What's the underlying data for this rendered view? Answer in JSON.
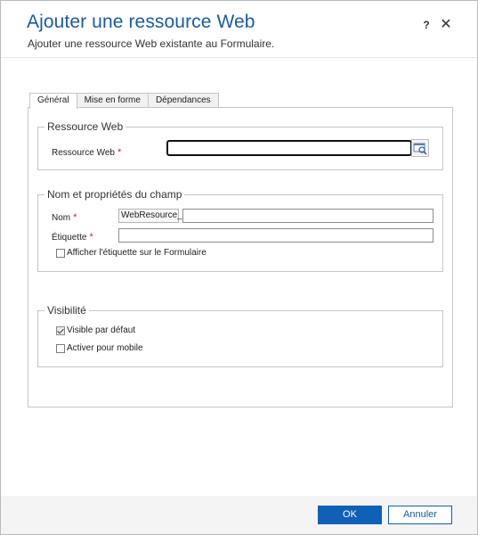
{
  "dialog": {
    "title": "Ajouter une ressource Web",
    "subtitle": "Ajouter une ressource Web existante au Formulaire.",
    "help_label": "?",
    "close_label": "✕"
  },
  "tabs": [
    {
      "label": "Général",
      "active": true
    },
    {
      "label": "Mise en forme",
      "active": false
    },
    {
      "label": "Dépendances",
      "active": false
    }
  ],
  "sections": {
    "web_resource": {
      "legend": "Ressource Web",
      "field_label": "Ressource Web",
      "field_value": "",
      "required_mark": "*"
    },
    "name_props": {
      "legend": "Nom et propriétés du champ",
      "name_label": "Nom",
      "name_prefix": "WebResource_",
      "name_value": "",
      "label_label": "Étiquette",
      "label_value": "",
      "required_mark": "*",
      "show_label_checkbox": "Afficher l'étiquette sur le Formulaire",
      "show_label_checked": false
    },
    "visibility": {
      "legend": "Visibilité",
      "visible_default": "Visible par défaut",
      "visible_default_checked": true,
      "enable_mobile": "Activer pour mobile",
      "enable_mobile_checked": false
    }
  },
  "footer": {
    "ok_label": "OK",
    "cancel_label": "Annuler"
  },
  "colors": {
    "title": "#1a5aa8",
    "primary_button": "#1160b7",
    "required": "#c4262e"
  },
  "icons": {
    "lookup": "lookup-icon",
    "close": "close-icon",
    "help": "help-icon"
  }
}
